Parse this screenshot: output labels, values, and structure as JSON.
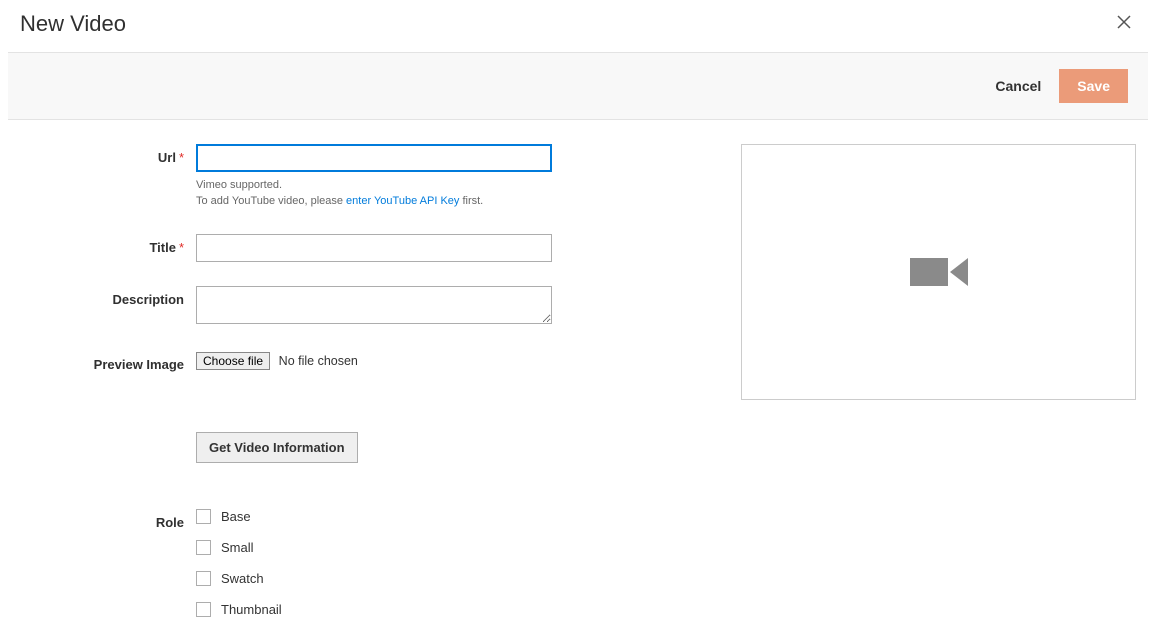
{
  "header": {
    "title": "New Video"
  },
  "actions": {
    "cancel": "Cancel",
    "save": "Save"
  },
  "form": {
    "url": {
      "label": "Url",
      "value": "",
      "help_line1": "Vimeo supported.",
      "help_line2_prefix": "To add YouTube video, please ",
      "help_link_text": "enter YouTube API Key",
      "help_line2_suffix": " first."
    },
    "title": {
      "label": "Title",
      "value": ""
    },
    "description": {
      "label": "Description",
      "value": ""
    },
    "preview_image": {
      "label": "Preview Image",
      "choose_label": "Choose file",
      "status": "No file chosen"
    },
    "get_info_label": "Get Video Information",
    "role": {
      "label": "Role",
      "options": [
        "Base",
        "Small",
        "Swatch",
        "Thumbnail"
      ]
    }
  }
}
